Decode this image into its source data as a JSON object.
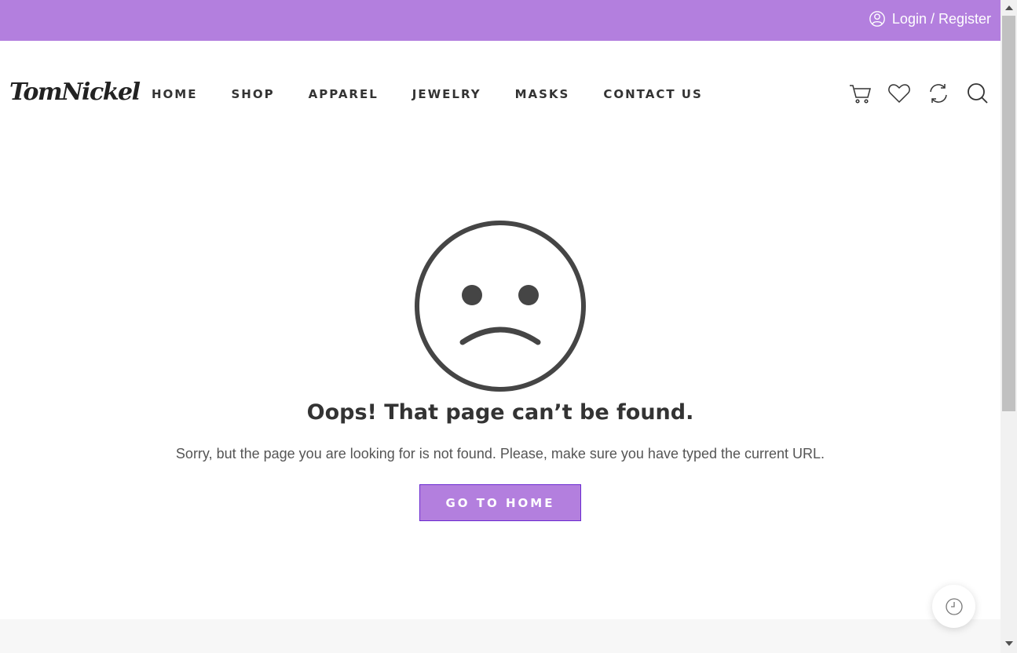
{
  "topbar": {
    "login_label": "Login / Register",
    "accent_color": "#b37fde"
  },
  "header": {
    "logo_text": "TomNickel",
    "nav": [
      "HOME",
      "SHOP",
      "APPAREL",
      "JEWELRY",
      "MASKS",
      "CONTACT US"
    ],
    "icons": [
      "cart-icon",
      "heart-icon",
      "compare-icon",
      "search-icon"
    ]
  },
  "error": {
    "title": "Oops! That page can’t be found.",
    "description": "Sorry, but the page you are looking for is not found. Please, make sure you have typed the current URL.",
    "button_label": "GO TO HOME",
    "icon": "sad-face-icon"
  },
  "floating": {
    "icon": "clock-icon"
  }
}
